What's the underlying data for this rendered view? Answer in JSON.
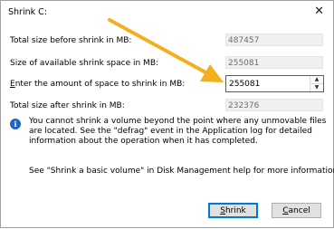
{
  "window": {
    "title": "Shrink C:"
  },
  "fields": {
    "total_before": {
      "label": "Total size before shrink in MB:",
      "value": "487457"
    },
    "available": {
      "label": "Size of available shrink space in MB:",
      "value": "255081"
    },
    "amount": {
      "label": "Enter the amount of space to shrink in MB:",
      "value": "255081"
    },
    "total_after": {
      "label": "Total size after shrink in MB:",
      "value": "232376"
    }
  },
  "info": {
    "text": "You cannot shrink a volume beyond the point where any unmovable files are located. See the \"defrag\" event in the Application log for detailed information about the operation when it has completed."
  },
  "help": {
    "text": "See \"Shrink a basic volume\" in Disk Management help for more information"
  },
  "buttons": {
    "shrink": "Shrink",
    "cancel": "Cancel"
  },
  "colors": {
    "annotation_arrow": "#f2b01e",
    "accent": "#0078d7",
    "info_icon": "#1f63c6"
  },
  "icons": {
    "close": "close-icon",
    "info": "info-icon",
    "spin_up": "chevron-up-icon",
    "spin_down": "chevron-down-icon",
    "annotation": "arrow-annotation"
  }
}
